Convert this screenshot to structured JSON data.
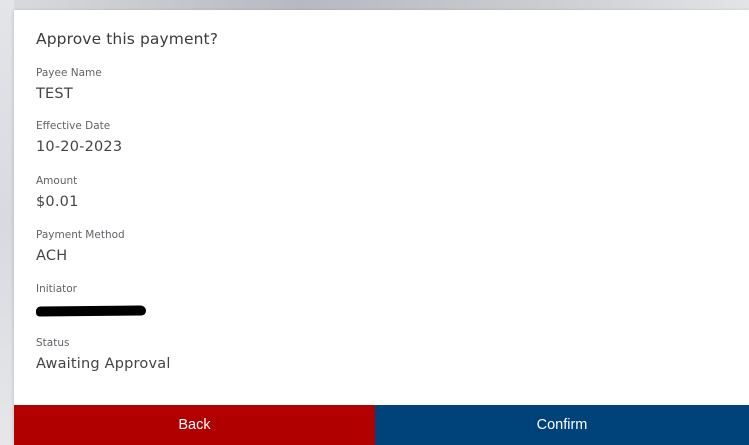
{
  "dialog": {
    "title": "Approve this payment?",
    "fields": [
      {
        "label": "Payee Name",
        "value": "TEST"
      },
      {
        "label": "Effective Date",
        "value": "10-20-2023"
      },
      {
        "label": "Amount",
        "value": "$0.01"
      },
      {
        "label": "Payment Method",
        "value": "ACH"
      },
      {
        "label": "Initiator",
        "value": ""
      },
      {
        "label": "Status",
        "value": "Awaiting Approval"
      }
    ]
  },
  "footer": {
    "back_label": "Back",
    "confirm_label": "Confirm"
  },
  "colors": {
    "back": "#b10000",
    "confirm": "#00427a"
  }
}
